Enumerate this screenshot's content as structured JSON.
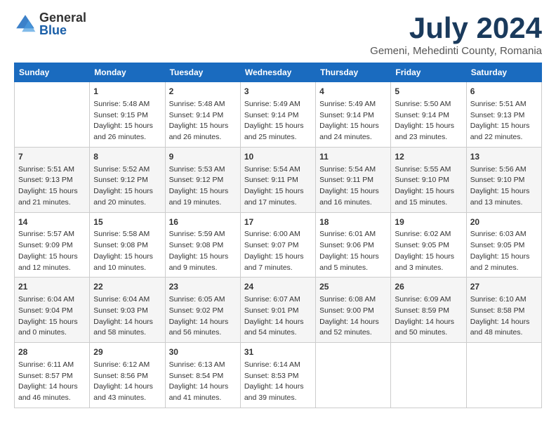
{
  "header": {
    "logo_general": "General",
    "logo_blue": "Blue",
    "main_title": "July 2024",
    "subtitle": "Gemeni, Mehedinti County, Romania"
  },
  "calendar": {
    "weekdays": [
      "Sunday",
      "Monday",
      "Tuesday",
      "Wednesday",
      "Thursday",
      "Friday",
      "Saturday"
    ],
    "weeks": [
      [
        {
          "day": "",
          "info": ""
        },
        {
          "day": "1",
          "info": "Sunrise: 5:48 AM\nSunset: 9:15 PM\nDaylight: 15 hours\nand 26 minutes."
        },
        {
          "day": "2",
          "info": "Sunrise: 5:48 AM\nSunset: 9:14 PM\nDaylight: 15 hours\nand 26 minutes."
        },
        {
          "day": "3",
          "info": "Sunrise: 5:49 AM\nSunset: 9:14 PM\nDaylight: 15 hours\nand 25 minutes."
        },
        {
          "day": "4",
          "info": "Sunrise: 5:49 AM\nSunset: 9:14 PM\nDaylight: 15 hours\nand 24 minutes."
        },
        {
          "day": "5",
          "info": "Sunrise: 5:50 AM\nSunset: 9:14 PM\nDaylight: 15 hours\nand 23 minutes."
        },
        {
          "day": "6",
          "info": "Sunrise: 5:51 AM\nSunset: 9:13 PM\nDaylight: 15 hours\nand 22 minutes."
        }
      ],
      [
        {
          "day": "7",
          "info": "Sunrise: 5:51 AM\nSunset: 9:13 PM\nDaylight: 15 hours\nand 21 minutes."
        },
        {
          "day": "8",
          "info": "Sunrise: 5:52 AM\nSunset: 9:12 PM\nDaylight: 15 hours\nand 20 minutes."
        },
        {
          "day": "9",
          "info": "Sunrise: 5:53 AM\nSunset: 9:12 PM\nDaylight: 15 hours\nand 19 minutes."
        },
        {
          "day": "10",
          "info": "Sunrise: 5:54 AM\nSunset: 9:11 PM\nDaylight: 15 hours\nand 17 minutes."
        },
        {
          "day": "11",
          "info": "Sunrise: 5:54 AM\nSunset: 9:11 PM\nDaylight: 15 hours\nand 16 minutes."
        },
        {
          "day": "12",
          "info": "Sunrise: 5:55 AM\nSunset: 9:10 PM\nDaylight: 15 hours\nand 15 minutes."
        },
        {
          "day": "13",
          "info": "Sunrise: 5:56 AM\nSunset: 9:10 PM\nDaylight: 15 hours\nand 13 minutes."
        }
      ],
      [
        {
          "day": "14",
          "info": "Sunrise: 5:57 AM\nSunset: 9:09 PM\nDaylight: 15 hours\nand 12 minutes."
        },
        {
          "day": "15",
          "info": "Sunrise: 5:58 AM\nSunset: 9:08 PM\nDaylight: 15 hours\nand 10 minutes."
        },
        {
          "day": "16",
          "info": "Sunrise: 5:59 AM\nSunset: 9:08 PM\nDaylight: 15 hours\nand 9 minutes."
        },
        {
          "day": "17",
          "info": "Sunrise: 6:00 AM\nSunset: 9:07 PM\nDaylight: 15 hours\nand 7 minutes."
        },
        {
          "day": "18",
          "info": "Sunrise: 6:01 AM\nSunset: 9:06 PM\nDaylight: 15 hours\nand 5 minutes."
        },
        {
          "day": "19",
          "info": "Sunrise: 6:02 AM\nSunset: 9:05 PM\nDaylight: 15 hours\nand 3 minutes."
        },
        {
          "day": "20",
          "info": "Sunrise: 6:03 AM\nSunset: 9:05 PM\nDaylight: 15 hours\nand 2 minutes."
        }
      ],
      [
        {
          "day": "21",
          "info": "Sunrise: 6:04 AM\nSunset: 9:04 PM\nDaylight: 15 hours\nand 0 minutes."
        },
        {
          "day": "22",
          "info": "Sunrise: 6:04 AM\nSunset: 9:03 PM\nDaylight: 14 hours\nand 58 minutes."
        },
        {
          "day": "23",
          "info": "Sunrise: 6:05 AM\nSunset: 9:02 PM\nDaylight: 14 hours\nand 56 minutes."
        },
        {
          "day": "24",
          "info": "Sunrise: 6:07 AM\nSunset: 9:01 PM\nDaylight: 14 hours\nand 54 minutes."
        },
        {
          "day": "25",
          "info": "Sunrise: 6:08 AM\nSunset: 9:00 PM\nDaylight: 14 hours\nand 52 minutes."
        },
        {
          "day": "26",
          "info": "Sunrise: 6:09 AM\nSunset: 8:59 PM\nDaylight: 14 hours\nand 50 minutes."
        },
        {
          "day": "27",
          "info": "Sunrise: 6:10 AM\nSunset: 8:58 PM\nDaylight: 14 hours\nand 48 minutes."
        }
      ],
      [
        {
          "day": "28",
          "info": "Sunrise: 6:11 AM\nSunset: 8:57 PM\nDaylight: 14 hours\nand 46 minutes."
        },
        {
          "day": "29",
          "info": "Sunrise: 6:12 AM\nSunset: 8:56 PM\nDaylight: 14 hours\nand 43 minutes."
        },
        {
          "day": "30",
          "info": "Sunrise: 6:13 AM\nSunset: 8:54 PM\nDaylight: 14 hours\nand 41 minutes."
        },
        {
          "day": "31",
          "info": "Sunrise: 6:14 AM\nSunset: 8:53 PM\nDaylight: 14 hours\nand 39 minutes."
        },
        {
          "day": "",
          "info": ""
        },
        {
          "day": "",
          "info": ""
        },
        {
          "day": "",
          "info": ""
        }
      ]
    ]
  }
}
